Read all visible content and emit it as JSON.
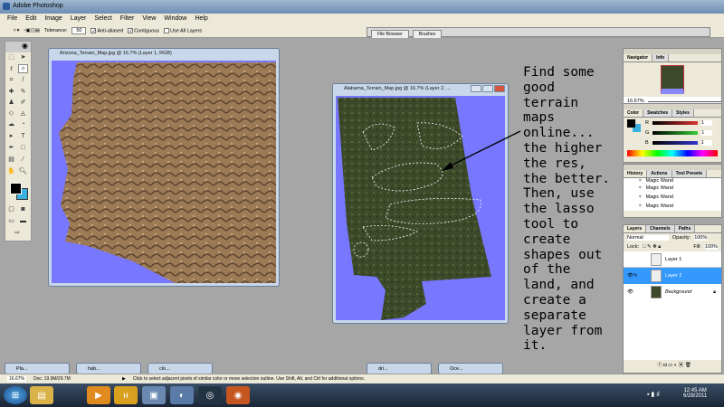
{
  "app": {
    "title": "Adobe Photoshop"
  },
  "menu": [
    "File",
    "Edit",
    "Image",
    "Layer",
    "Select",
    "Filter",
    "View",
    "Window",
    "Help"
  ],
  "options": {
    "tolerance_label": "Tolerance:",
    "tolerance_value": "50",
    "anti_aliased": "Anti-aliased",
    "contiguous": "Contiguous",
    "use_all_layers": "Use All Layers"
  },
  "well_tabs": [
    "File Browser",
    "Brushes"
  ],
  "windows": {
    "arizona": "Arizona_Terrain_Map.jpg @ 16.7% (Layer 1, RGB)",
    "alabama": "Alabama_Terrain_Map.jpg @ 16.7% (Layer 2, ..."
  },
  "note": "Find some\ngood\nterrain\nmaps\nonline...\nthe higher\nthe res,\nthe better.\nThen, use\nthe lasso\ntool to\ncreate\nshapes out\nof the\nland, and\ncreate a\nseparate\nlayer from\nit.",
  "navigator": {
    "tabs": [
      "Navigator",
      "Info"
    ],
    "zoom": "16.67%"
  },
  "color": {
    "tabs": [
      "Color",
      "Swatches",
      "Styles"
    ],
    "r": "R",
    "g": "G",
    "b": "B",
    "r_val": "1",
    "g_val": "1",
    "b_val": "1"
  },
  "history": {
    "tabs": [
      "History",
      "Actions",
      "Tool Presets"
    ],
    "items": [
      "Magic Wand",
      "Magic Wand",
      "Magic Wand",
      "Magic Wand"
    ]
  },
  "layers": {
    "tabs": [
      "Layers",
      "Channels",
      "Paths"
    ],
    "blend": "Normal",
    "opacity_label": "Opacity:",
    "opacity": "100%",
    "lock_label": "Lock:",
    "fill_label": "Fill:",
    "fill": "100%",
    "items": [
      "Layer 1",
      "Layer 2",
      "Background"
    ]
  },
  "minimized": [
    "Pla...",
    "hab...",
    "clo...",
    "dri...",
    "Oce..."
  ],
  "status": {
    "zoom": "16.67%",
    "doc": "Doc: 19.9M/29.7M",
    "hint": "Click to select adjacent pixels of similar color or move selection outline. Use Shift, Alt, and Ctrl for additional options."
  },
  "clock": {
    "time": "12:45 AM",
    "date": "6/28/2011"
  }
}
